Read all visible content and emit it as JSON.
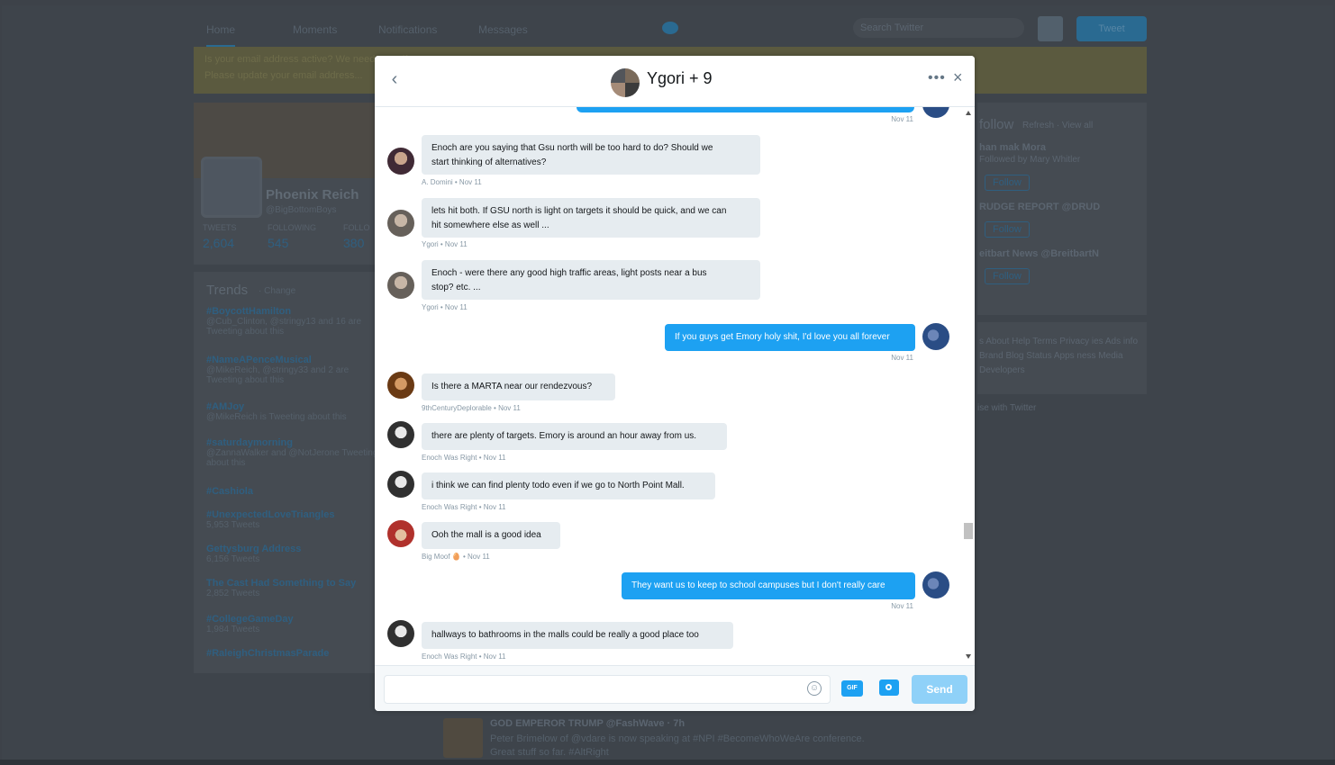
{
  "background": {
    "nav": {
      "home": "Home",
      "moments": "Moments",
      "notifications": "Notifications",
      "messages": "Messages",
      "search_placeholder": "Search Twitter",
      "tweet_button": "Tweet"
    },
    "alert": {
      "line1": "Is your email address active? We need to verify your account...",
      "line2": "Please update your email address..."
    },
    "profile": {
      "name": "Phoenix Reich",
      "handle": "@BigBottomBoys",
      "tweets_label": "TWEETS",
      "tweets_value": "2,604",
      "following_label": "FOLLOWING",
      "following_value": "545",
      "followers_label": "FOLLO",
      "followers_value": "380"
    },
    "trends": {
      "title": "Trends",
      "change": "· Change",
      "items": [
        {
          "tag": "#BoycottHamilton",
          "sub": "@Cub_Clinton, @stringy13 and 16 are Tweeting about this"
        },
        {
          "tag": "#NameAPenceMusical",
          "sub": "@MikeReich, @stringy33 and 2 are Tweeting about this"
        },
        {
          "tag": "#AMJoy",
          "sub": "@MikeReich is Tweeting about this"
        },
        {
          "tag": "#saturdaymorning",
          "sub": "@ZannaWalker and @NotJerone Tweeting about this"
        },
        {
          "tag": "#Cashiola",
          "sub": ""
        },
        {
          "tag": "#UnexpectedLoveTriangles",
          "sub": "5,953 Tweets"
        },
        {
          "tag": "Gettysburg Address",
          "sub": "6,156 Tweets"
        },
        {
          "tag": "The Cast Had Something to Say",
          "sub": "2,852 Tweets"
        },
        {
          "tag": "#CollegeGameDay",
          "sub": "1,984 Tweets"
        },
        {
          "tag": "#RaleighChristmasParade",
          "sub": ""
        }
      ]
    },
    "who_to_follow": {
      "title": "follow",
      "refresh": "Refresh · View all",
      "items": [
        {
          "name": "han mak Mora",
          "sub": "Followed by Mary Whitler",
          "follow": "Follow"
        },
        {
          "name": "RUDGE REPORT @DRUD",
          "sub": "",
          "follow": "Follow"
        },
        {
          "name": "eitbart News @BreitbartN",
          "sub": "",
          "follow": "Follow"
        }
      ],
      "footer": "s  About  Help  Terms  Privacy  ies  Ads info  Brand  Blog  Status  Apps  ness  Media  Developers",
      "advertise": "ise with Twitter"
    },
    "bottom_tweet": {
      "name": "GOD EMPEROR TRUMP @FashWave · 7h",
      "text": "Peter Brimelow of @vdare is now speaking at #NPI #BecomeWhoWeAre conference. Great stuff so far. #AltRight"
    }
  },
  "modal": {
    "title": "Ygori + 9",
    "more_icon": "•••",
    "close_icon": "×",
    "back_icon": "‹",
    "top_meta": "Nov 11",
    "messages": [
      {
        "direction": "in",
        "text_line1": "Enoch are you saying that Gsu north will be too hard to do? Should we",
        "text_line2": "start thinking of alternatives?",
        "meta": "A. Domini • Nov 11",
        "avatar": "A. Domini"
      },
      {
        "direction": "in",
        "text_line1": "lets hit both. If GSU north is light on targets it should be quick, and we can",
        "text_line2": "hit somewhere else as well ...",
        "meta": "Ygori • Nov 11",
        "avatar": "Ygori"
      },
      {
        "direction": "in",
        "text_line1": "Enoch - were there any good high traffic areas, light posts near a bus",
        "text_line2": "stop? etc. ...",
        "meta": "Ygori • Nov 11",
        "avatar": "Ygori"
      },
      {
        "direction": "out",
        "text_line1": "If you guys get Emory holy shit, I'd love you all forever",
        "meta": "Nov 11"
      },
      {
        "direction": "in",
        "text_line1": "Is there a MARTA near our rendezvous?",
        "meta": "9thCenturyDeplorable • Nov 11",
        "avatar": "9thCenturyDeplorable"
      },
      {
        "direction": "in",
        "text_line1": "there are plenty of targets. Emory is around an hour away from us.",
        "meta": "Enoch Was Right • Nov 11",
        "avatar": "Enoch Was Right"
      },
      {
        "direction": "in",
        "text_line1": "i think we can find plenty todo even if we go to North Point Mall.",
        "meta": "Enoch Was Right • Nov 11",
        "avatar": "Enoch Was Right"
      },
      {
        "direction": "in",
        "text_line1": "Ooh the mall is a good idea",
        "meta": "Big Moof 🥚 • Nov 11",
        "avatar": "Big Moof"
      },
      {
        "direction": "out",
        "text_line1": "They want us to keep to school campuses but I don't really care",
        "meta": "Nov 11"
      },
      {
        "direction": "in",
        "text_line1": "hallways to bathrooms in the malls could be really a good place too",
        "meta": "Enoch Was Right • Nov 11",
        "avatar": "Enoch Was Right"
      }
    ],
    "composer": {
      "placeholder": "",
      "emoji_icon": "☺",
      "gif_label": "GIF",
      "send_label": "Send"
    }
  },
  "colors": {
    "accent": "#1da1f2",
    "bubble_in": "#e6ecf0",
    "overlay": "#3e444b"
  }
}
